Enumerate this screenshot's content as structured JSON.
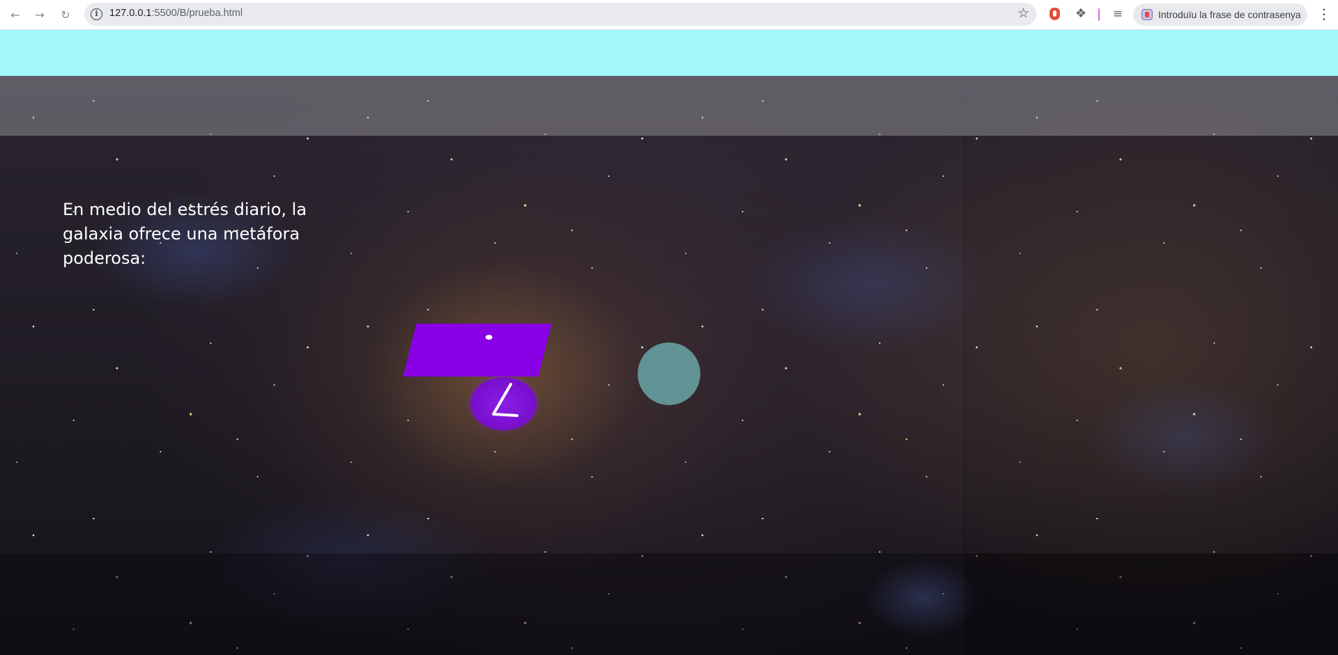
{
  "browser": {
    "url_host": "127.0.0.1",
    "url_path": ":5500/B/prueba.html",
    "password_prompt": "Introduïu la frase de contrasenya",
    "icons": [
      "back-icon",
      "forward-icon",
      "reload-icon",
      "site-info-icon",
      "bookmark-star-icon",
      "extension-shield-icon",
      "extensions-puzzle-icon",
      "reading-list-icon",
      "password-manager-icon",
      "menu-kebab-icon"
    ]
  },
  "page": {
    "header_bar_color": "#a3f8fc",
    "hero_text": "En medio del estrés diario, la galaxia ofrece una metáfora poderosa:",
    "shapes": {
      "rectangle_color": "#8a00e6",
      "ellipse_color": "#7a10cf",
      "ellipse_glyph": "∠",
      "circle_color": "#619294"
    }
  }
}
